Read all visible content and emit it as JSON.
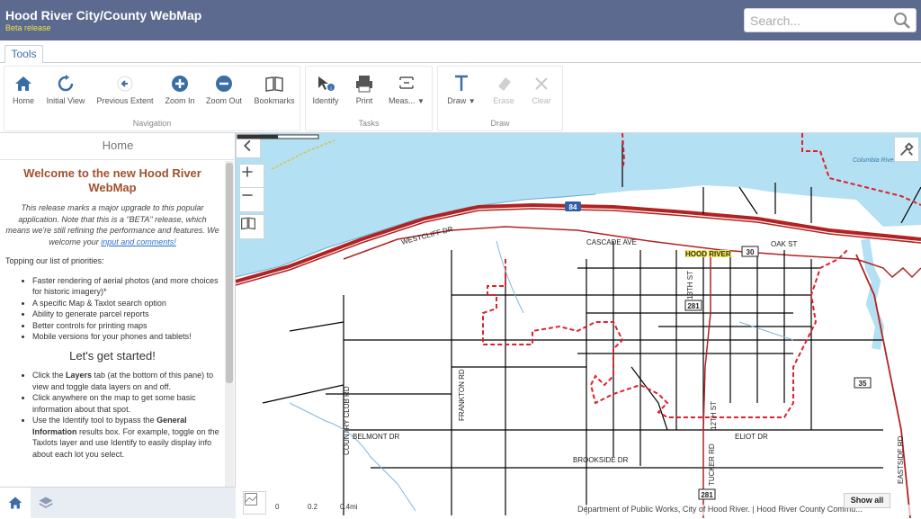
{
  "header": {
    "title": "Hood River City/County WebMap",
    "subtitle": "Beta release",
    "search_placeholder": "Search..."
  },
  "toolbar": {
    "tab_label": "Tools",
    "groups": {
      "navigation": {
        "title": "Navigation",
        "home": "Home",
        "initial_view": "Initial View",
        "previous_extent": "Previous Extent",
        "zoom_in": "Zoom In",
        "zoom_out": "Zoom Out",
        "bookmarks": "Bookmarks"
      },
      "tasks": {
        "title": "Tasks",
        "identify": "Identify",
        "print": "Print",
        "measure": "Meas..."
      },
      "draw": {
        "title": "Draw",
        "draw": "Draw",
        "erase": "Erase",
        "clear": "Clear"
      }
    }
  },
  "side_panel": {
    "header": "Home",
    "welcome_title": "Welcome to the new Hood River WebMap",
    "intro_text": "This release marks a major upgrade to this popular application.  Note that this is a \"BETA\" release, which means we're still refining the performance and features.  We welcome your",
    "intro_link": "input and comments!",
    "priorities_heading": "Topping our list of priorities:",
    "priorities": [
      "Faster rendering of aerial photos (and more choices for historic imagery)*",
      "A specific Map & Taxlot search option",
      "Ability to generate parcel reports",
      "Better controls for printing maps",
      "Mobile versions for your phones and tablets!"
    ],
    "started_heading": "Let's get started!",
    "tips": {
      "t1_pre": "Click the ",
      "t1_bold": "Layers",
      "t1_post": " tab (at the bottom of this pane) to view and toggle data layers on and off.",
      "t2": "Click anywhere on the map to get some basic information about that spot.",
      "t3_pre": "Use the Identify tool to bypass the ",
      "t3_bold": "General Information",
      "t3_post": " results box. For example, toggle on the Taxlots layer and use Identify to easily display info about each lot you select."
    }
  },
  "map": {
    "road_labels": {
      "westcliff": "WESTCLIFF DR",
      "cascade": "CASCADE AVE",
      "hood_river": "HOOD RIVER",
      "oak": "OAK ST",
      "frankton": "FRANKTON RD",
      "country_club": "COUNTRY CLUB RD",
      "belmont": "BELMONT DR",
      "brookside": "BROOKSIDE DR",
      "eliot": "ELIOT DR",
      "tucker": "TUCKER RD",
      "st13": "13TH ST",
      "st12": "12TH ST",
      "eastside": "EASTSIDE RD",
      "columbia": "Columbia River"
    },
    "shields": [
      "84",
      "30",
      "281",
      "281",
      "35"
    ],
    "scale_labels": [
      "0",
      "0.2",
      "0.4mi"
    ],
    "attribution": "Department of Public Works, City of Hood River. | Hood River County Commu...",
    "show_all": "Show all"
  },
  "colors": {
    "header_bg": "#5c6a8f",
    "subtitle": "#f2e341",
    "welcome_title": "#a0522d",
    "water": "#b3e0f2",
    "highway": "#b22222",
    "boundary": "#e0202a"
  }
}
